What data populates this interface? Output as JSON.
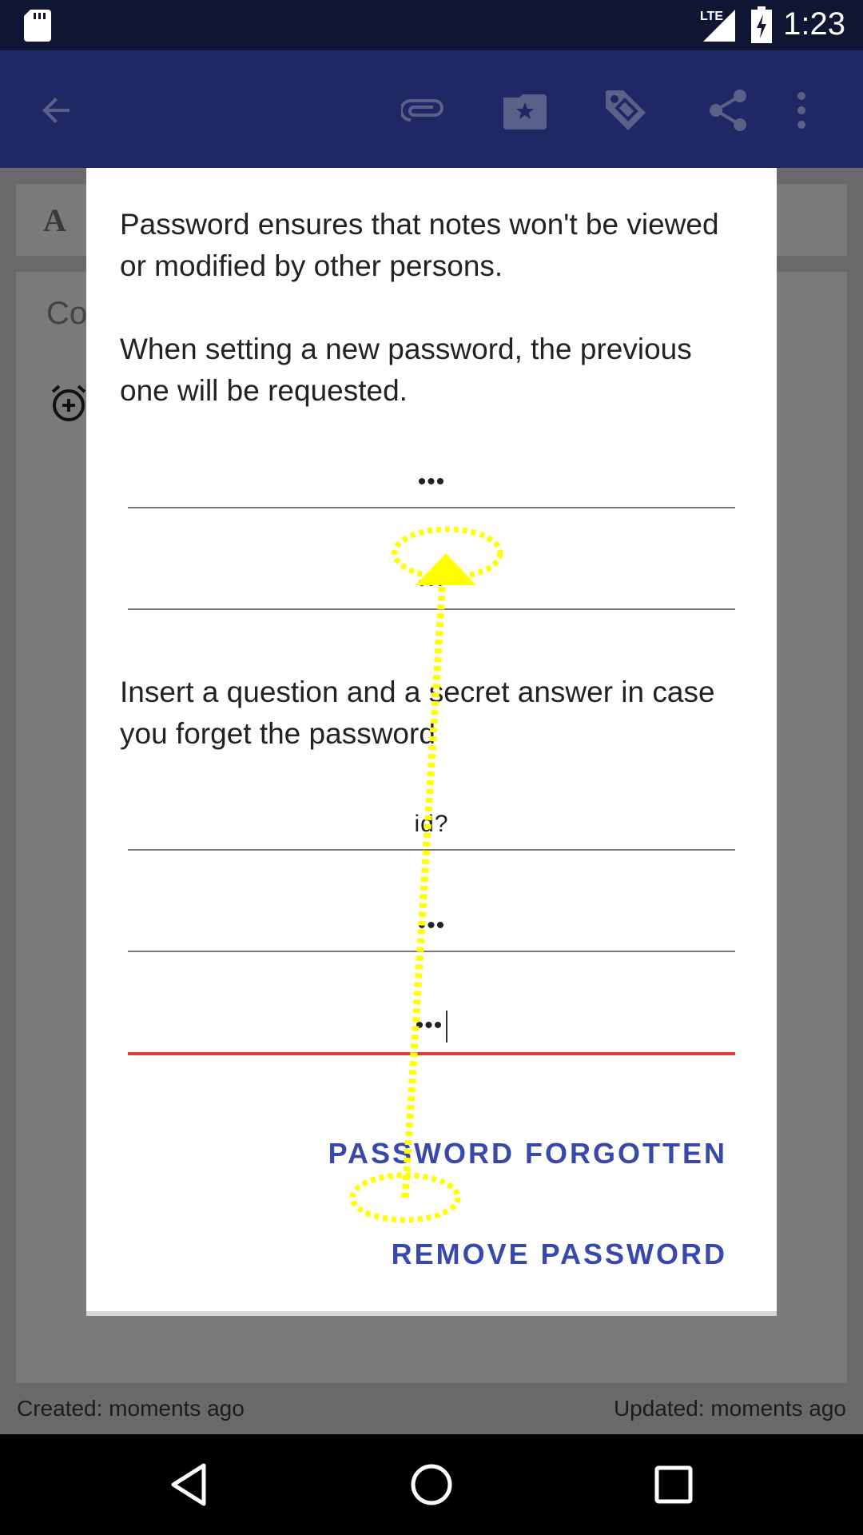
{
  "status_bar": {
    "time": "1:23",
    "network": "LTE"
  },
  "toolbar": {
    "icons": [
      "back-arrow-icon",
      "attachment-icon",
      "bookmark-star-icon",
      "tag-icon",
      "share-icon",
      "more-vert-icon"
    ]
  },
  "background": {
    "title_initial": "A",
    "content_placeholder": "Co",
    "footer": {
      "created": "Created: moments ago",
      "updated": "Updated: moments ago"
    }
  },
  "dialog": {
    "intro_line1": "Password ensures that notes won't be viewed or modified by other persons.",
    "intro_line2": "When setting a new password, the previous one will be requested.",
    "password_value": "•••",
    "password_confirm_value": "•••",
    "question_intro": "Insert a question and a secret answer in case you forget the password",
    "question_value": "id?",
    "answer_value": "•••",
    "answer_confirm_value": "•••",
    "password_forgotten_label": "PASSWORD FORGOTTEN",
    "remove_password_label": "REMOVE PASSWORD"
  },
  "colors": {
    "status_bar": "#0f1533",
    "toolbar": "#1f2865",
    "accent_button": "#3949ab",
    "active_underline": "#e53935",
    "gesture_annotation": "#ffff00"
  }
}
